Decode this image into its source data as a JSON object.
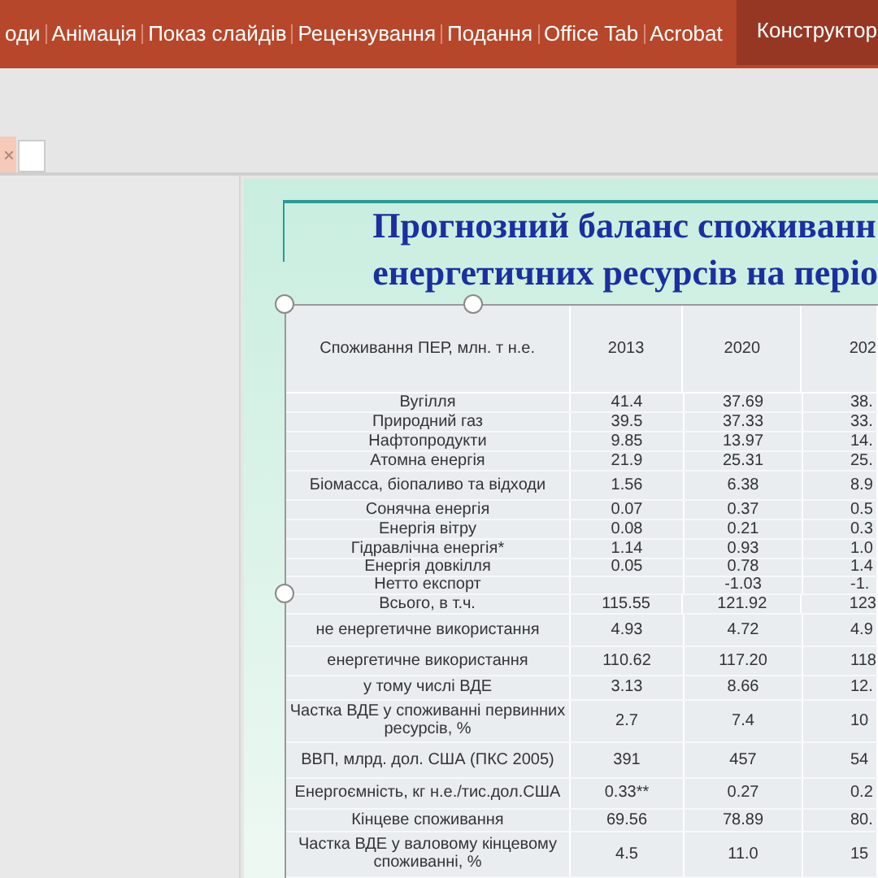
{
  "ribbon_tabs": [
    {
      "label": "оди",
      "selected": false
    },
    {
      "label": "Анімація",
      "selected": false
    },
    {
      "label": "Показ слайдів",
      "selected": false
    },
    {
      "label": "Рецензування",
      "selected": false
    },
    {
      "label": "Подання",
      "selected": false
    },
    {
      "label": "Office Tab",
      "selected": false
    },
    {
      "label": "Acrobat",
      "selected": false
    },
    {
      "label": "Конструктор",
      "selected": true
    }
  ],
  "slide": {
    "title_lines": [
      "Прогнозний баланс споживанн",
      "енергетичних ресурсів на періо"
    ],
    "table": {
      "columns": [
        "Споживання ПЕР, млн. т н.е.",
        "2013",
        "2020",
        "202"
      ],
      "rows": [
        [
          "Вугілля",
          "41.4",
          "37.69",
          "38."
        ],
        [
          "Природний газ",
          "39.5",
          "37.33",
          "33."
        ],
        [
          "Нафтопродукти",
          "9.85",
          "13.97",
          "14."
        ],
        [
          "Атомна енергія",
          "21.9",
          "25.31",
          "25."
        ],
        [
          "Біомасса, біопаливо та відходи",
          "1.56",
          "6.38",
          "8.9"
        ],
        [
          "Сонячна енергія",
          "0.07",
          "0.37",
          "0.5"
        ],
        [
          "Енергія вітру",
          "0.08",
          "0.21",
          "0.3"
        ],
        [
          "Гідравлічна енергія*",
          "1.14",
          "0.93",
          "1.0"
        ],
        [
          "Енергія довкілля",
          "0.05",
          "0.78",
          "1.4"
        ],
        [
          "Нетто експорт",
          "",
          "-1.03",
          "-1."
        ],
        [
          "Всього, в т.ч.",
          "115.55",
          "121.92",
          "123"
        ],
        [
          "не енергетичне використання",
          "4.93",
          "4.72",
          "4.9"
        ],
        [
          "енергетичне використання",
          "110.62",
          "117.20",
          "118"
        ],
        [
          "у тому числі ВДЕ",
          "3.13",
          "8.66",
          "12."
        ],
        [
          "Частка ВДЕ у споживанні первинних ресурсів, %",
          "2.7",
          "7.4",
          "10"
        ],
        [
          "ВВП, млрд. дол. США (ПКС 2005)",
          "391",
          "457",
          "54"
        ],
        [
          "Енергоємність, кг н.е./тис.дол.США",
          "0.33**",
          "0.27",
          "0.2"
        ],
        [
          "Кінцеве споживання",
          "69.56",
          "78.89",
          "80."
        ],
        [
          "Частка ВДЕ у валовому кінцевому споживанні, %",
          "4.5",
          "11.0",
          "15"
        ]
      ]
    }
  }
}
